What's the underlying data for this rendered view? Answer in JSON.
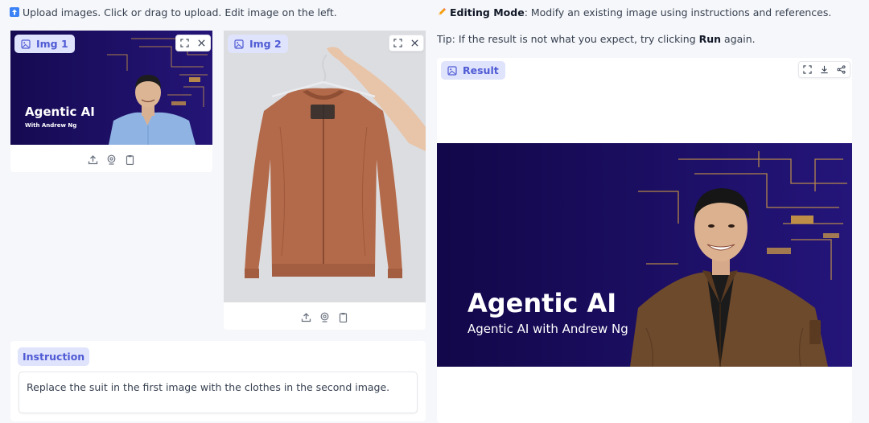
{
  "left_header": {
    "icon": "upload-emoji-icon",
    "text": "Upload images. Click or drag to upload. Edit image on the left."
  },
  "right_header": {
    "icon": "pencil-emoji-icon",
    "mode_label": "Editing Mode",
    "mode_text": ": Modify an existing image using instructions and references.",
    "tip_prefix": "Tip: If the result is not what you expect, try clicking ",
    "tip_button": "Run",
    "tip_suffix": " again."
  },
  "images": [
    {
      "label": "Img 1",
      "banner_title": "Agentic AI",
      "banner_subtitle": "With Andrew Ng"
    },
    {
      "label": "Img 2"
    }
  ],
  "instruction": {
    "label": "Instruction",
    "value": "Replace the suit in the first image with the clothes in the second image."
  },
  "result": {
    "label": "Result",
    "banner_title": "Agentic AI",
    "banner_subtitle": "Agentic AI with Andrew Ng"
  },
  "colors": {
    "accent": "#4f5bd5",
    "chip_bg": "#dfe3fb",
    "banner_dark": "#1a0f5c",
    "circuit_gold": "#d9a441",
    "jacket": "#b36a4a",
    "bomber_brown": "#6e4a2c"
  }
}
